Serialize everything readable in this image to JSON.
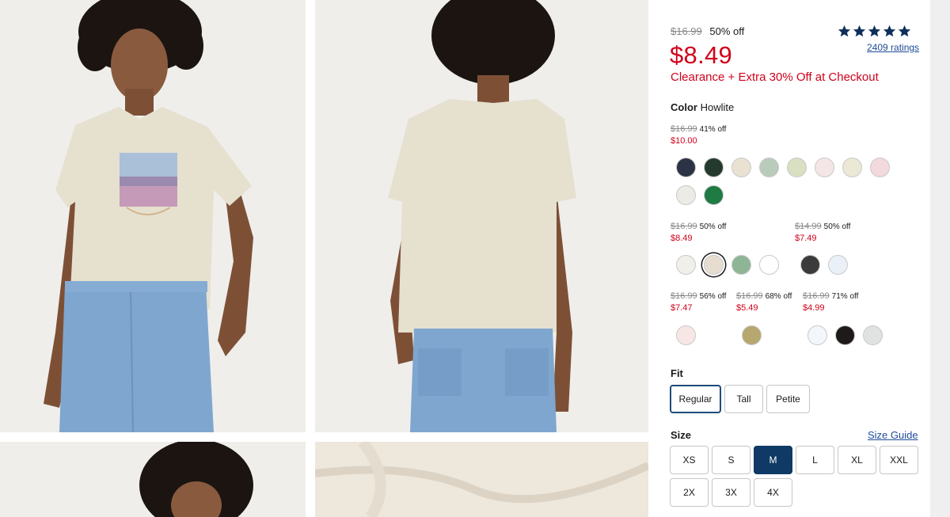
{
  "gallery": {
    "images": [
      "model-front-photo",
      "model-back-photo",
      "model-closeup-photo",
      "fabric-detail-photo"
    ]
  },
  "price": {
    "original": "$16.99",
    "discount": "50% off",
    "current": "$8.49",
    "promo": "Clearance + Extra 30% Off at Checkout"
  },
  "rating": {
    "stars": 5,
    "count_label": "2409 ratings"
  },
  "color": {
    "label": "Color",
    "selected": "Howlite"
  },
  "swatch_groups": [
    {
      "original": "$16.99",
      "discount": "41% off",
      "price": "$10.00"
    },
    {
      "original": "$16.99",
      "discount": "50% off",
      "price": "$8.49"
    },
    {
      "original": "$14.99",
      "discount": "50% off",
      "price": "$7.49"
    },
    {
      "original": "$16.99",
      "discount": "56% off",
      "price": "$7.47"
    },
    {
      "original": "$16.99",
      "discount": "68% off",
      "price": "$5.49"
    },
    {
      "original": "$16.99",
      "discount": "71% off",
      "price": "$4.99"
    }
  ],
  "fit": {
    "label": "Fit",
    "options": [
      "Regular",
      "Tall",
      "Petite"
    ],
    "selected": "Regular"
  },
  "size": {
    "label": "Size",
    "guide_label": "Size Guide",
    "options": [
      "XS",
      "S",
      "M",
      "L",
      "XL",
      "XXL",
      "2X",
      "3X",
      "4X"
    ],
    "selected": "M"
  },
  "colors": {
    "sale_red": "#d0021b",
    "link_blue": "#1f4b99",
    "selected_size_bg": "#0f3a66",
    "tee": "#e6e0cf",
    "denim": "#7fa6cf"
  }
}
